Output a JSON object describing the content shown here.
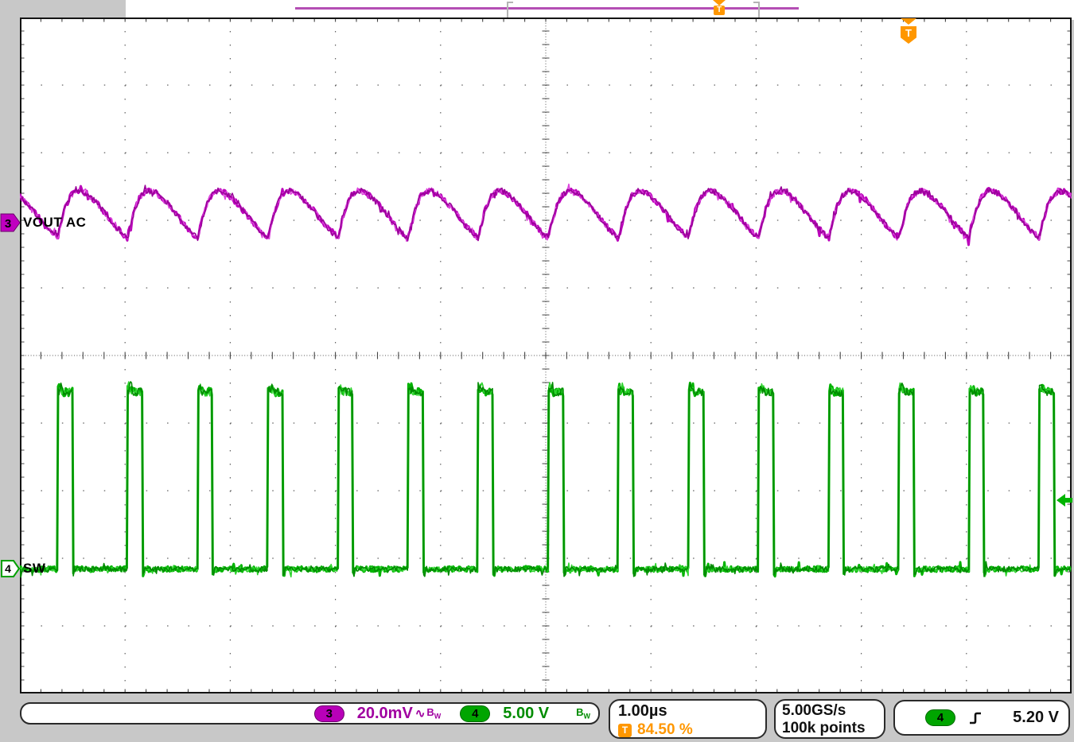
{
  "colors": {
    "magenta": "#c000c0",
    "green": "#00b400",
    "orange": "#ff9700",
    "background": "#c8c8c8",
    "grid_dots": "#555555"
  },
  "record_view": {
    "trigger_marker": "T"
  },
  "trigger_flag": {
    "label": "T"
  },
  "channels": {
    "ch3": {
      "number": "3",
      "label": "VOUT AC",
      "scale": "20.0mV",
      "ac_symbol": "∿",
      "bw": "B",
      "bw_sub": "W"
    },
    "ch4": {
      "number": "4",
      "label": "SW",
      "scale": "5.00 V",
      "bw": "B",
      "bw_sub": "W"
    }
  },
  "horizontal": {
    "time_per_div": "1.00µs",
    "trigger_badge": "T",
    "trigger_position": "84.50 %"
  },
  "acquisition": {
    "sample_rate": "5.00GS/s",
    "record_length": "100k points"
  },
  "trigger": {
    "source_channel": "4",
    "slope": "rising",
    "level": "5.20 V"
  },
  "chart_data": {
    "type": "line",
    "title": "Oscilloscope capture: VOUT AC ripple (CH3) and SW node pulses (CH4)",
    "x_axis": {
      "units": "µs",
      "seconds_per_div": "1.00µs",
      "divisions": 10,
      "range_us": [
        0,
        10
      ]
    },
    "y_axis": {
      "divisions": 10
    },
    "sample_rate": "5.00GS/s",
    "record_length": "100k points",
    "trigger": {
      "source": "CH4",
      "slope": "rising",
      "level_v": 5.2,
      "position_pct": 84.5
    },
    "grid": "dotted, center crosshair with minor ticks every 1/5 division",
    "series": [
      {
        "name": "VOUT AC",
        "channel": 3,
        "color": "#c000c0",
        "volts_per_div": "20.0mV",
        "mv_per_div": 20,
        "zero_div_from_top": 3.05,
        "period_us": 0.6667,
        "first_edge_us": 0.356,
        "ripple_mv_pp": 14,
        "noise_mv": 0.85,
        "cycle_keypoints_phase_mv": [
          [
            0,
            -4.5
          ],
          [
            0.04,
            -1.0
          ],
          [
            0.1,
            4.0
          ],
          [
            0.18,
            8.0
          ],
          [
            0.28,
            9.8
          ],
          [
            0.4,
            9.2
          ],
          [
            0.52,
            7.0
          ],
          [
            0.65,
            4.0
          ],
          [
            0.8,
            0.0
          ],
          [
            0.92,
            -2.8
          ],
          [
            0.985,
            -3.8
          ],
          [
            1,
            -4.5
          ]
        ]
      },
      {
        "name": "SW",
        "channel": 4,
        "color": "#00b400",
        "volts_per_div": "5.00 V",
        "v_per_div": 5,
        "zero_div_from_top": 8.16,
        "period_us": 0.6667,
        "first_rise_us": 0.356,
        "duty": 0.215,
        "high_v": 13.1,
        "overshoot_v": 0.5,
        "undershoot_v": -0.55,
        "noise_v": 0.2,
        "frequency_mhz": 1.5
      }
    ]
  }
}
